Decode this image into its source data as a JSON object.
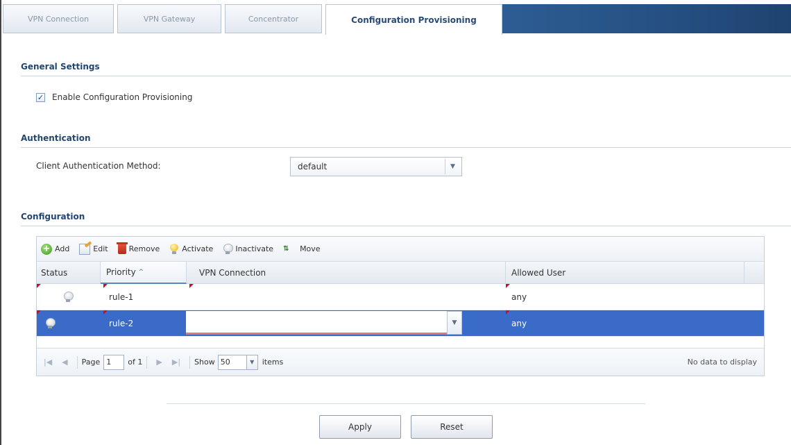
{
  "tabs": [
    {
      "label": "VPN Connection",
      "active": false
    },
    {
      "label": "VPN Gateway",
      "active": false
    },
    {
      "label": "Concentrator",
      "active": false
    },
    {
      "label": "Configuration Provisioning",
      "active": true
    }
  ],
  "general": {
    "title": "General Settings",
    "enable_label": "Enable Configuration Provisioning",
    "enable_checked": true
  },
  "authentication": {
    "title": "Authentication",
    "method_label": "Client Authentication Method:",
    "method_value": "default"
  },
  "configuration": {
    "title": "Configuration",
    "toolbar": {
      "add": "Add",
      "edit": "Edit",
      "remove": "Remove",
      "activate": "Activate",
      "inactivate": "Inactivate",
      "move": "Move"
    },
    "columns": {
      "status": "Status",
      "priority": "Priority",
      "priority_sort": "^",
      "vpn": "VPN Connection",
      "allowed_user": "Allowed User"
    },
    "rows": [
      {
        "priority": "rule-1",
        "vpn": "",
        "allowed_user": "any",
        "active": false,
        "selected": false
      },
      {
        "priority": "rule-2",
        "vpn": "",
        "allowed_user": "any",
        "active": false,
        "selected": true
      }
    ],
    "pager": {
      "page_label": "Page",
      "page_value": "1",
      "of_label": "of 1",
      "show_label": "Show",
      "show_value": "50",
      "items_label": "items",
      "status": "No data to display"
    }
  },
  "buttons": {
    "apply": "Apply",
    "reset": "Reset"
  }
}
